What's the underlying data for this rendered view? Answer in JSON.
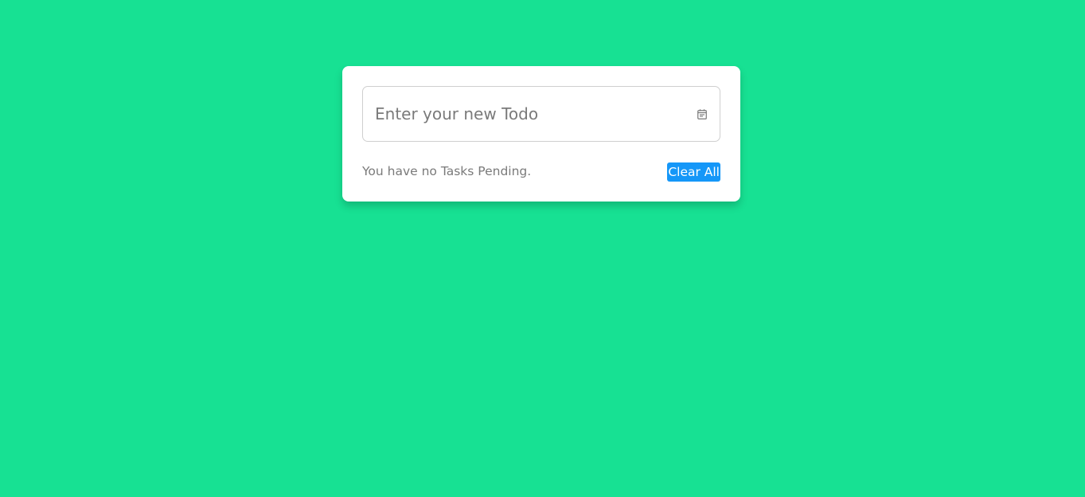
{
  "todo": {
    "input_value": "",
    "placeholder": "Enter your new Todo",
    "icon": "calendar-icon",
    "status_text": "You have no Tasks Pending.",
    "clear_label": "Clear All"
  },
  "colors": {
    "background": "#17e193",
    "card": "#ffffff",
    "button": "#1597f8",
    "muted_text": "#7a7a7a"
  }
}
